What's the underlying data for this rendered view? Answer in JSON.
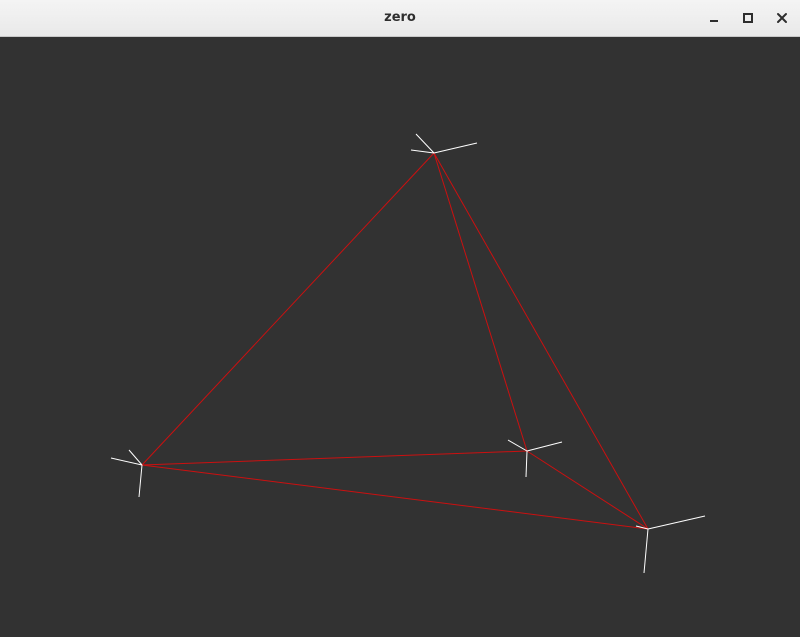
{
  "window": {
    "title": "zero",
    "controls": {
      "minimize": "minimize-icon",
      "maximize": "maximize-icon",
      "close": "close-icon"
    }
  },
  "scene": {
    "background": "#323232",
    "edge_color": "#cc1010",
    "axis_color": "#ffffff"
  }
}
